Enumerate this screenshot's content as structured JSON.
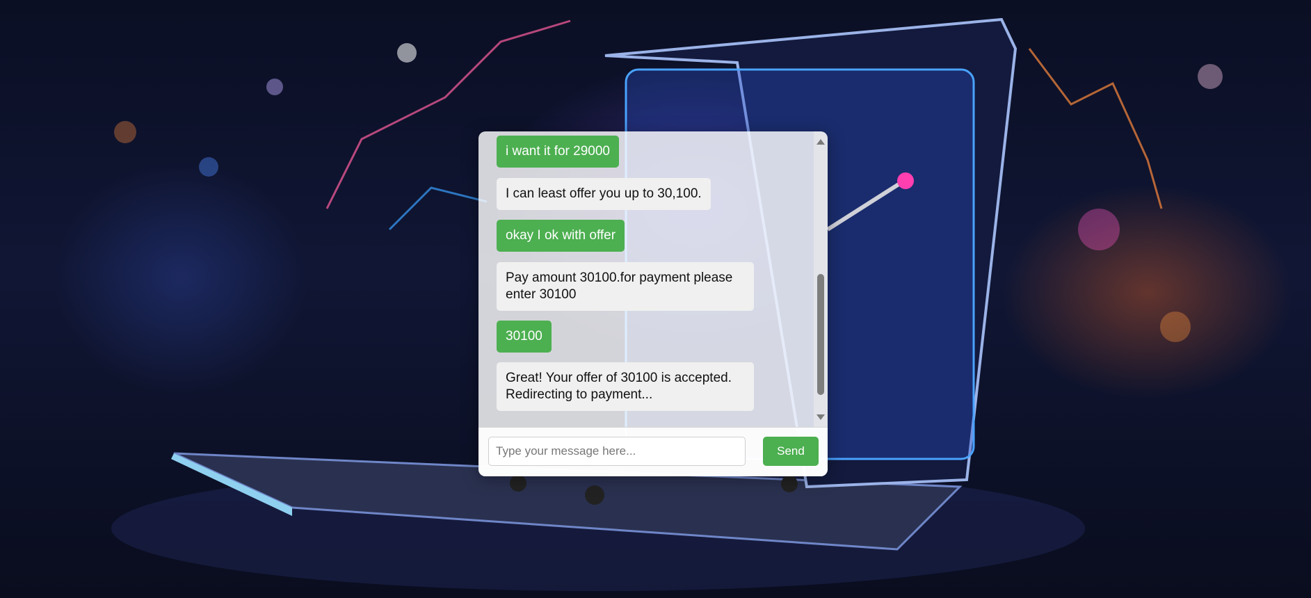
{
  "chat": {
    "messages": [
      {
        "sender": "user",
        "text": "i want it for 29000"
      },
      {
        "sender": "bot",
        "text": "I can least offer you up to 30,100."
      },
      {
        "sender": "user",
        "text": "okay I ok with offer"
      },
      {
        "sender": "bot",
        "text": "Pay amount 30100.for payment please enter 30100"
      },
      {
        "sender": "user",
        "text": "30100"
      },
      {
        "sender": "bot",
        "text": "Great! Your offer of 30100 is accepted. Redirecting to payment..."
      }
    ],
    "input": {
      "value": "",
      "placeholder": "Type your message here..."
    },
    "send_label": "Send"
  },
  "colors": {
    "user_bubble": "#4caf50",
    "bot_bubble": "#f0f0f0",
    "send_button": "#4caf50"
  },
  "background": {
    "description_icon": "laptop-shopping-cart-image"
  }
}
